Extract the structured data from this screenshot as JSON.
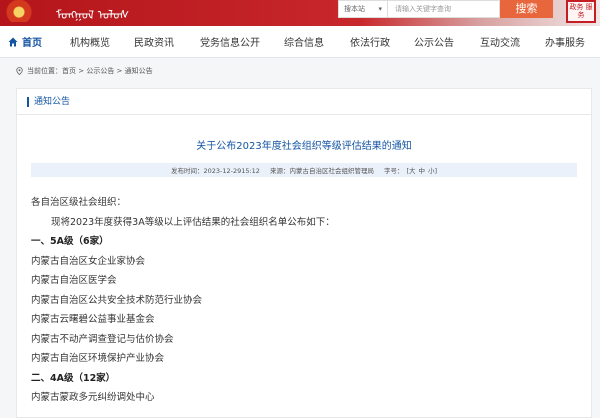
{
  "header": {
    "script_text": "ᠮᠣᠩᠭᠣᠯ ᠤᠯᠤᠰ",
    "search_scope": "搜本站",
    "search_placeholder": "请输入关键字查询",
    "search_button": "搜索",
    "seal_text": "政务 服务"
  },
  "nav": {
    "items": [
      {
        "label": "首页",
        "active": true
      },
      {
        "label": "机构概览"
      },
      {
        "label": "民政资讯"
      },
      {
        "label": "党务信息公开"
      },
      {
        "label": "综合信息"
      },
      {
        "label": "依法行政"
      },
      {
        "label": "公示公告"
      },
      {
        "label": "互动交流"
      },
      {
        "label": "办事服务"
      }
    ]
  },
  "breadcrumb": {
    "prefix": "当前位置：",
    "path": "首页 > 公示公告 > 通知公告"
  },
  "section": {
    "tab_label": "通知公告"
  },
  "article": {
    "title": "关于公布2023年度社会组织等级评估结果的通知",
    "publish_time": "发布时间：2023-12-2915:12",
    "source": "来源：内蒙古自治区社会组织管理局",
    "font_size_label": "字号：",
    "font_sizes": [
      "[大",
      "中",
      "小]"
    ],
    "lines": [
      {
        "text": "各自治区级社会组织：",
        "style": "normal"
      },
      {
        "text": "现将2023年度获得3A等级以上评估结果的社会组织名单公布如下：",
        "style": "indent"
      },
      {
        "text": "一、5A级（6家）",
        "style": "heading"
      },
      {
        "text": "内蒙古自治区女企业家协会",
        "style": "normal"
      },
      {
        "text": "内蒙古自治区医学会",
        "style": "normal"
      },
      {
        "text": "内蒙古自治区公共安全技术防范行业协会",
        "style": "normal"
      },
      {
        "text": "内蒙古云曙碧公益事业基金会",
        "style": "normal"
      },
      {
        "text": "内蒙古不动产调查登记与估价协会",
        "style": "normal"
      },
      {
        "text": "内蒙古自治区环境保护产业协会",
        "style": "normal"
      },
      {
        "text": "二、4A级（12家）",
        "style": "heading"
      },
      {
        "text": "内蒙古蒙政多元纠纷调处中心",
        "style": "normal"
      }
    ]
  }
}
